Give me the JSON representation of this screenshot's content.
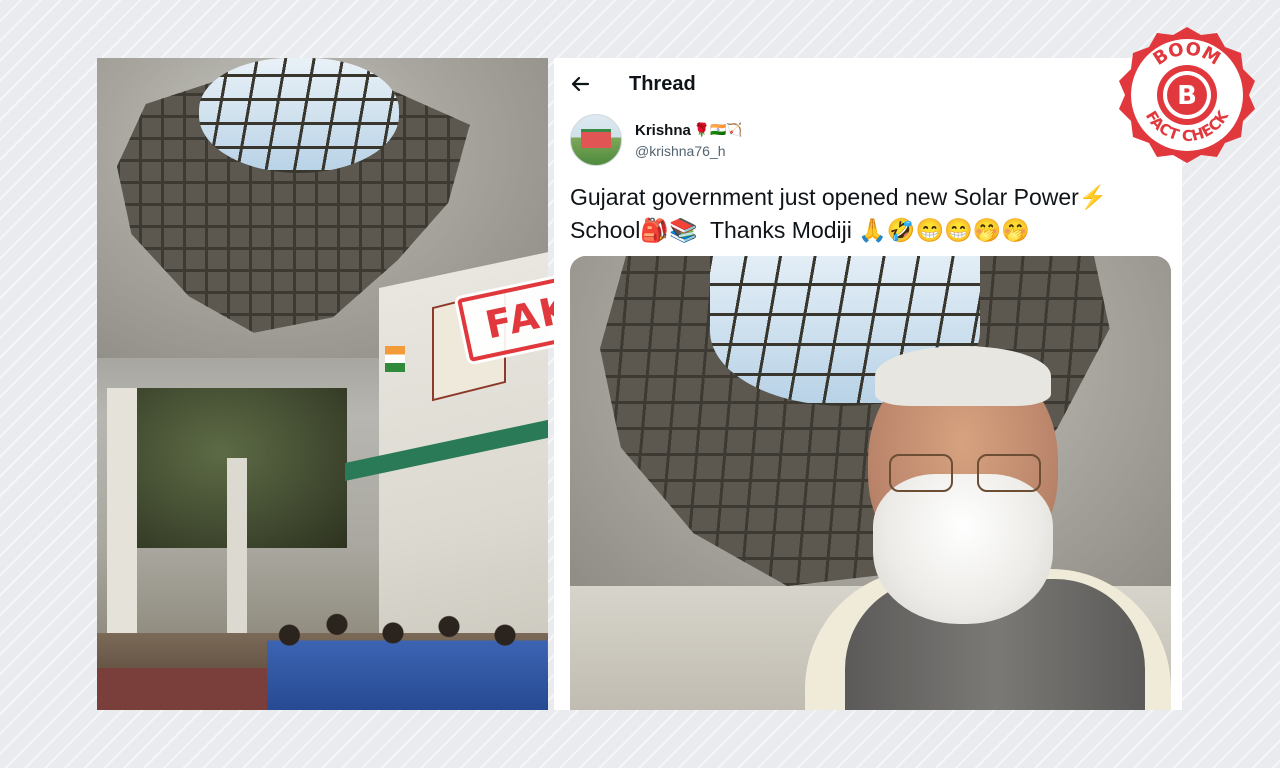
{
  "stamp": {
    "label": "FAKE"
  },
  "thread": {
    "title": "Thread",
    "back_icon": "arrow-left-icon"
  },
  "tweet": {
    "author_name": "Krishna",
    "author_emojis": "🌹🇮🇳🏹",
    "author_handle": "@krishna76_h",
    "text": "Gujarat government just opened new Solar Power⚡\nSchool🎒📚  Thanks Modiji 🙏🤣😁😁🤭🤭",
    "media_icon": "classroom-photo"
  },
  "logo": {
    "top_text": "BOOM",
    "letter": "B",
    "bottom_text": "FACT CHECK",
    "colors": {
      "red": "#e0383c",
      "white": "#ffffff"
    }
  },
  "colors": {
    "background": "#e9ebee",
    "stamp_red": "#e0383c",
    "tweet_text": "#0f1419",
    "handle_gray": "#536471"
  }
}
